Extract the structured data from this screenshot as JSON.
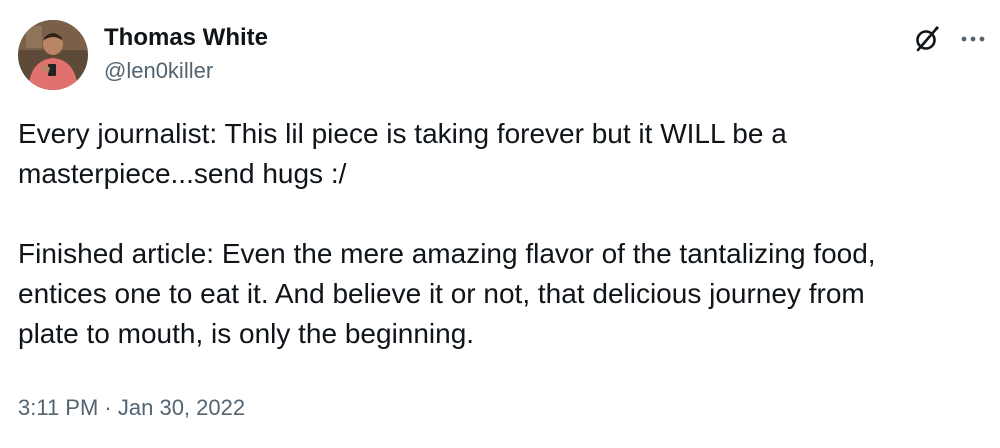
{
  "author": {
    "display_name": "Thomas White",
    "handle": "@len0killer"
  },
  "tweet": {
    "paragraphs": [
      "Every journalist: This lil piece is taking forever but it WILL be a\nmasterpiece...send hugs :/",
      "Finished article: Even the mere amazing flavor of the tantalizing food,\nentices one to eat it. And believe it or not, that delicious journey from\nplate to mouth, is only the beginning."
    ]
  },
  "meta": {
    "time": "3:11 PM",
    "separator": " · ",
    "date": "Jan 30, 2022"
  },
  "icons": {
    "top_right": [
      "grok-icon",
      "more-options-icon"
    ]
  },
  "colors": {
    "text_primary": "#0f1419",
    "text_secondary": "#536471",
    "background": "#ffffff"
  }
}
